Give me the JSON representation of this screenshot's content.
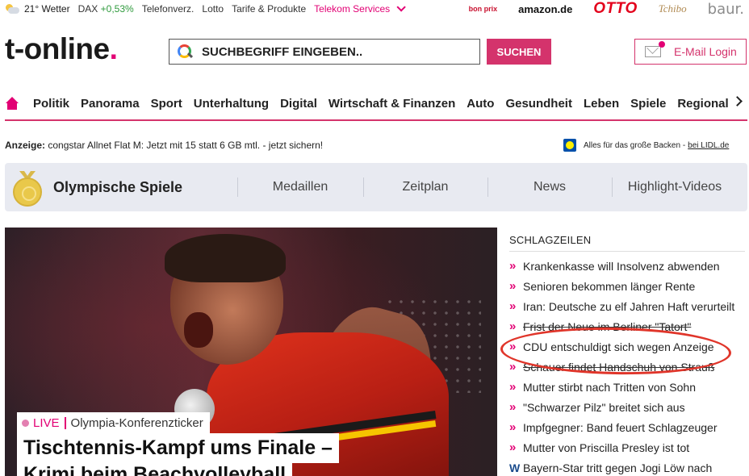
{
  "topbar": {
    "weather": "21° Wetter",
    "dax_label": "DAX",
    "dax_change": "+0,53%",
    "links": [
      "Telefonverz.",
      "Lotto",
      "Tarife & Produkte"
    ],
    "telekom": "Telekom Services"
  },
  "partners": {
    "bonprix": "bon prix",
    "amazon": "amazon.de",
    "otto": "OTTO",
    "tchibo": "Tchibo",
    "baur": "baur."
  },
  "logo": {
    "text": "t-online",
    "dot": "."
  },
  "search": {
    "placeholder": "SUCHBEGRIFF EINGEBEN..",
    "button": "SUCHEN"
  },
  "mail": {
    "label": "E-Mail Login"
  },
  "nav": {
    "items": [
      "Politik",
      "Panorama",
      "Sport",
      "Unterhaltung",
      "Digital",
      "Wirtschaft & Finanzen",
      "Auto",
      "Gesundheit",
      "Leben",
      "Spiele",
      "Regional"
    ]
  },
  "ad": {
    "label": "Anzeige:",
    "text": "congstar Allnet Flat M: Jetzt mit 15 statt 6 GB mtl. - jetzt sichern!",
    "lidl_text": "Alles für das große Backen -",
    "lidl_link": "bei LIDL.de"
  },
  "olympics": {
    "title": "Olympische Spiele",
    "tabs": [
      "Medaillen",
      "Zeitplan",
      "News",
      "Highlight-Videos"
    ]
  },
  "hero": {
    "live": "LIVE",
    "ticker": "Olympia-Konferenzticker",
    "headline1": "Tischtennis-Kampf ums Finale –",
    "headline2": "Krimi beim Beachvolleyball"
  },
  "schlagzeilen": {
    "title": "SCHLAGZEILEN",
    "items": [
      "Krankenkasse will Insolvenz abwenden",
      "Senioren bekommen länger Rente",
      "Iran: Deutsche zu elf Jahren Haft verurteilt",
      "Frist der Neue im Berliner \"Tatort\"",
      "CDU entschuldigt sich wegen Anzeige",
      "Schauer findet Handschuh von Strauß",
      "Mutter stirbt nach Tritten von Sohn",
      "\"Schwarzer Pilz\" breitet sich aus",
      "Impfgegner: Band feuert Schlagzeuger",
      "Mutter von Priscilla Presley ist tot",
      "Bayern-Star tritt gegen Jogi Löw nach"
    ],
    "last_icon": "W"
  },
  "colors": {
    "brand": "#e20074",
    "button": "#d4336c",
    "annotation": "#e0352a"
  }
}
